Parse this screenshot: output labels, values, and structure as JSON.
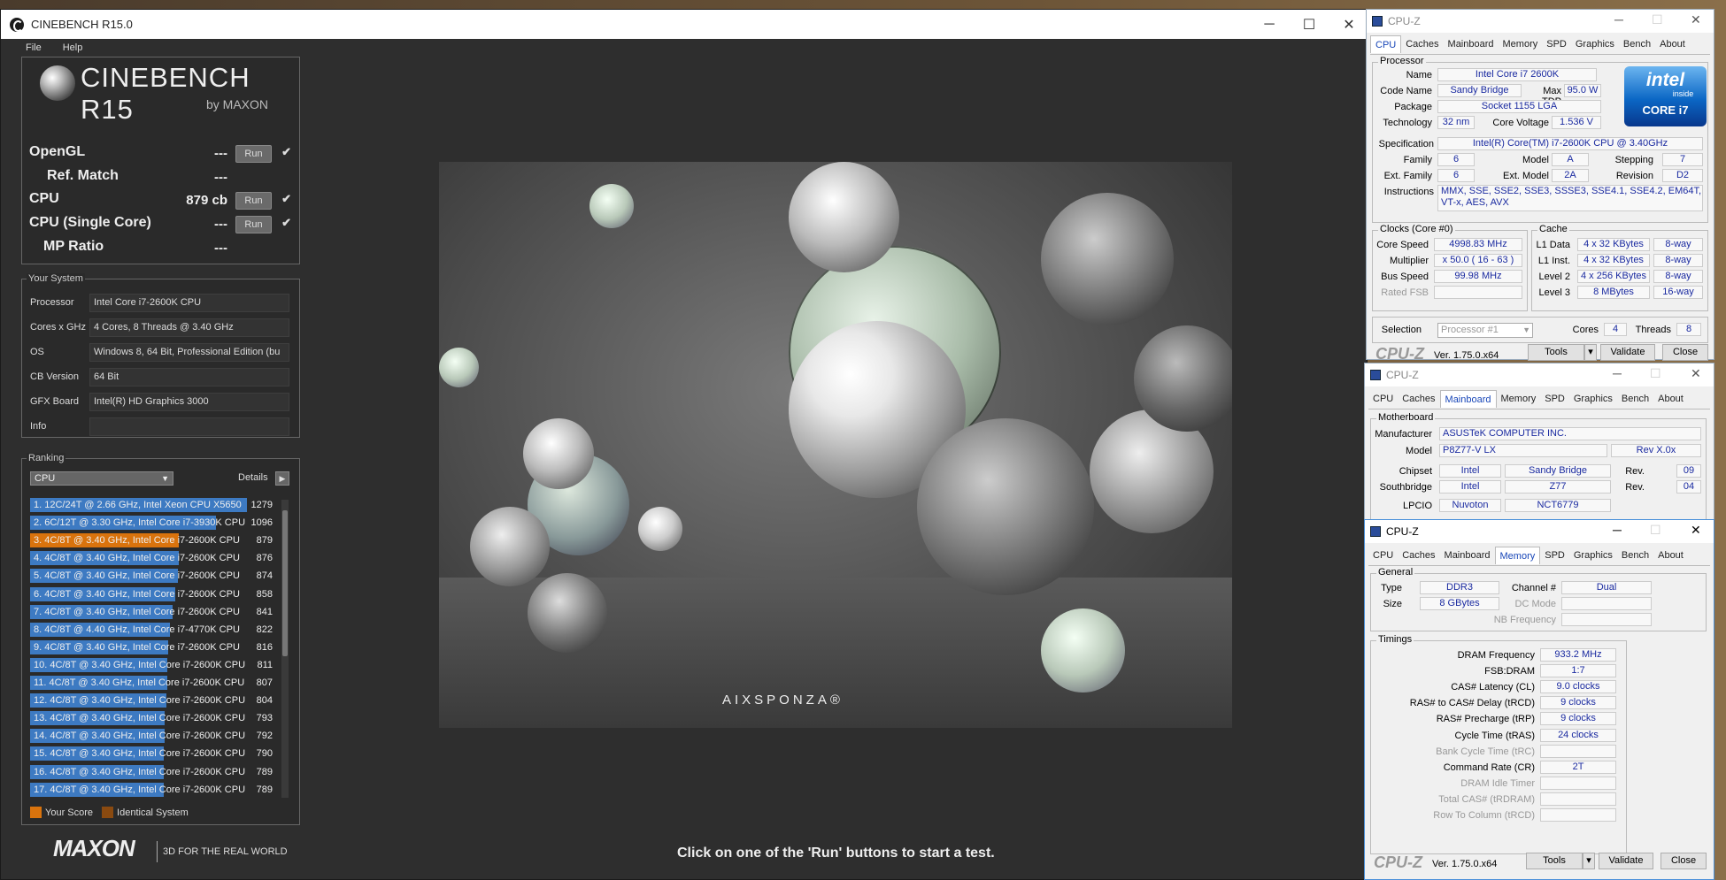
{
  "cinebench": {
    "window_title": "CINEBENCH R15.0",
    "menu": [
      "File",
      "Help"
    ],
    "logo_title": "CINEBENCH R15",
    "logo_sub": "by MAXON",
    "tests": [
      {
        "label": "OpenGL",
        "value": "---",
        "run": "Run"
      },
      {
        "label": "Ref. Match",
        "value": "---"
      },
      {
        "label": "CPU",
        "value": "879 cb",
        "run": "Run"
      },
      {
        "label": "CPU (Single Core)",
        "value": "---",
        "run": "Run"
      },
      {
        "label": "MP Ratio",
        "value": "---"
      }
    ],
    "system_title": "Your System",
    "system": [
      {
        "label": "Processor",
        "value": "Intel Core i7-2600K CPU"
      },
      {
        "label": "Cores x GHz",
        "value": "4 Cores, 8 Threads @ 3.40 GHz"
      },
      {
        "label": "OS",
        "value": "Windows 8, 64 Bit, Professional Edition (bu"
      },
      {
        "label": "CB Version",
        "value": "64 Bit"
      },
      {
        "label": "GFX Board",
        "value": "Intel(R) HD Graphics 3000"
      },
      {
        "label": "Info",
        "value": ""
      }
    ],
    "ranking_title": "Ranking",
    "ranking_select": "CPU",
    "details_label": "Details",
    "ranking": [
      {
        "label": "1. 12C/24T @ 2.66 GHz, Intel Xeon CPU X5650",
        "score": "1279",
        "fill": 1.0,
        "me": false
      },
      {
        "label": "2. 6C/12T @ 3.30 GHz,  Intel Core i7-3930K CPU",
        "score": "1096",
        "fill": 0.857,
        "me": false
      },
      {
        "label": "3. 4C/8T @ 3.40 GHz,  Intel Core i7-2600K CPU",
        "score": "879",
        "fill": 0.687,
        "me": true
      },
      {
        "label": "4. 4C/8T @ 3.40 GHz,  Intel Core i7-2600K CPU",
        "score": "876",
        "fill": 0.685,
        "me": false
      },
      {
        "label": "5. 4C/8T @ 3.40 GHz,  Intel Core i7-2600K CPU",
        "score": "874",
        "fill": 0.683,
        "me": false
      },
      {
        "label": "6. 4C/8T @ 3.40 GHz,  Intel Core i7-2600K CPU",
        "score": "858",
        "fill": 0.671,
        "me": false
      },
      {
        "label": "7. 4C/8T @ 3.40 GHz,  Intel Core i7-2600K CPU",
        "score": "841",
        "fill": 0.658,
        "me": false
      },
      {
        "label": "8. 4C/8T @ 4.40 GHz, Intel Core i7-4770K CPU",
        "score": "822",
        "fill": 0.643,
        "me": false
      },
      {
        "label": "9. 4C/8T @ 3.40 GHz,  Intel Core i7-2600K CPU",
        "score": "816",
        "fill": 0.638,
        "me": false
      },
      {
        "label": "10. 4C/8T @ 3.40 GHz,  Intel Core i7-2600K CPU",
        "score": "811",
        "fill": 0.634,
        "me": false
      },
      {
        "label": "11. 4C/8T @ 3.40 GHz,  Intel Core i7-2600K CPU",
        "score": "807",
        "fill": 0.631,
        "me": false
      },
      {
        "label": "12. 4C/8T @ 3.40 GHz,  Intel Core i7-2600K CPU",
        "score": "804",
        "fill": 0.629,
        "me": false
      },
      {
        "label": "13. 4C/8T @ 3.40 GHz,  Intel Core i7-2600K CPU",
        "score": "793",
        "fill": 0.62,
        "me": false
      },
      {
        "label": "14. 4C/8T @ 3.40 GHz,  Intel Core i7-2600K CPU",
        "score": "792",
        "fill": 0.619,
        "me": false
      },
      {
        "label": "15. 4C/8T @ 3.40 GHz,  Intel Core i7-2600K CPU",
        "score": "790",
        "fill": 0.618,
        "me": false
      },
      {
        "label": "16. 4C/8T @ 3.40 GHz,  Intel Core i7-2600K CPU",
        "score": "789",
        "fill": 0.617,
        "me": false
      },
      {
        "label": "17. 4C/8T @ 3.40 GHz,  Intel Core i7-2600K CPU",
        "score": "789",
        "fill": 0.617,
        "me": false
      }
    ],
    "legend_your": "Your Score",
    "legend_identical": "Identical System",
    "brand": "MAXON",
    "tagline": "3D FOR THE REAL WORLD",
    "render_brand": "AIXSPONZA®",
    "status": "Click on one of the 'Run' buttons to start a test.",
    "colors": {
      "your_score": "#d9730d",
      "identical": "#8a4a10",
      "bar": "#3d7ac2"
    }
  },
  "cpuz": {
    "title": "CPU-Z",
    "tabs": [
      "CPU",
      "Caches",
      "Mainboard",
      "Memory",
      "SPD",
      "Graphics",
      "Bench",
      "About"
    ],
    "version": "Ver. 1.75.0.x64",
    "tools": "Tools",
    "validate": "Validate",
    "close": "Close",
    "cpu": {
      "processor_group": "Processor",
      "name_label": "Name",
      "name": "Intel Core i7 2600K",
      "codename_label": "Code Name",
      "codename": "Sandy Bridge",
      "maxtdp_label": "Max TDP",
      "maxtdp": "95.0 W",
      "package_label": "Package",
      "package": "Socket 1155 LGA",
      "tech_label": "Technology",
      "tech": "32 nm",
      "voltage_label": "Core Voltage",
      "voltage": "1.536 V",
      "spec_label": "Specification",
      "spec": "Intel(R) Core(TM) i7-2600K CPU @ 3.40GHz",
      "family_label": "Family",
      "family": "6",
      "model_label": "Model",
      "model": "A",
      "stepping_label": "Stepping",
      "stepping": "7",
      "extfamily_label": "Ext. Family",
      "extfamily": "6",
      "extmodel_label": "Ext. Model",
      "extmodel": "2A",
      "revision_label": "Revision",
      "revision": "D2",
      "instr_label": "Instructions",
      "instr": "MMX, SSE, SSE2, SSE3, SSSE3, SSE4.1, SSE4.2, EM64T, VT-x, AES, AVX",
      "clocks_group": "Clocks (Core #0)",
      "corespeed_label": "Core Speed",
      "corespeed": "4998.83 MHz",
      "mult_label": "Multiplier",
      "mult": "x 50.0 ( 16 - 63 )",
      "bus_label": "Bus Speed",
      "bus": "99.98 MHz",
      "ratedfsb_label": "Rated FSB",
      "cache_group": "Cache",
      "l1d_label": "L1 Data",
      "l1d": "4 x 32 KBytes",
      "l1d_way": "8-way",
      "l1i_label": "L1 Inst.",
      "l1i": "4 x 32 KBytes",
      "l1i_way": "8-way",
      "l2_label": "Level 2",
      "l2": "4 x 256 KBytes",
      "l2_way": "8-way",
      "l3_label": "Level 3",
      "l3": "8 MBytes",
      "l3_way": "16-way",
      "selection_label": "Selection",
      "selection": "Processor #1",
      "cores_label": "Cores",
      "cores": "4",
      "threads_label": "Threads",
      "threads": "8",
      "intel_top": "intel",
      "intel_inside": "inside",
      "intel_core": "CORE i7"
    },
    "mainboard": {
      "group": "Motherboard",
      "manufacturer_label": "Manufacturer",
      "manufacturer": "ASUSTeK COMPUTER INC.",
      "model_label": "Model",
      "model": "P8Z77-V LX",
      "rev": "Rev X.0x",
      "chipset_label": "Chipset",
      "chipset": "Intel",
      "chipset_name": "Sandy Bridge",
      "chipset_rev_label": "Rev.",
      "chipset_rev": "09",
      "south_label": "Southbridge",
      "south": "Intel",
      "south_name": "Z77",
      "south_rev_label": "Rev.",
      "south_rev": "04",
      "lpcio_label": "LPCIO",
      "lpcio": "Nuvoton",
      "lpcio_name": "NCT6779"
    },
    "memory": {
      "general_group": "General",
      "type_label": "Type",
      "type": "DDR3",
      "size_label": "Size",
      "size": "8 GBytes",
      "channel_label": "Channel #",
      "channel": "Dual",
      "dcmode_label": "DC Mode",
      "nbfreq_label": "NB Frequency",
      "timings_group": "Timings",
      "timings": [
        {
          "label": "DRAM Frequency",
          "value": "933.2 MHz",
          "dim": false
        },
        {
          "label": "FSB:DRAM",
          "value": "1:7",
          "dim": false
        },
        {
          "label": "CAS# Latency (CL)",
          "value": "9.0 clocks",
          "dim": false
        },
        {
          "label": "RAS# to CAS# Delay (tRCD)",
          "value": "9 clocks",
          "dim": false
        },
        {
          "label": "RAS# Precharge (tRP)",
          "value": "9 clocks",
          "dim": false
        },
        {
          "label": "Cycle Time (tRAS)",
          "value": "24 clocks",
          "dim": false
        },
        {
          "label": "Bank Cycle Time (tRC)",
          "value": "",
          "dim": true
        },
        {
          "label": "Command Rate (CR)",
          "value": "2T",
          "dim": false
        },
        {
          "label": "DRAM Idle Timer",
          "value": "",
          "dim": true
        },
        {
          "label": "Total CAS# (tRDRAM)",
          "value": "",
          "dim": true
        },
        {
          "label": "Row To Column (tRCD)",
          "value": "",
          "dim": true
        }
      ]
    }
  }
}
